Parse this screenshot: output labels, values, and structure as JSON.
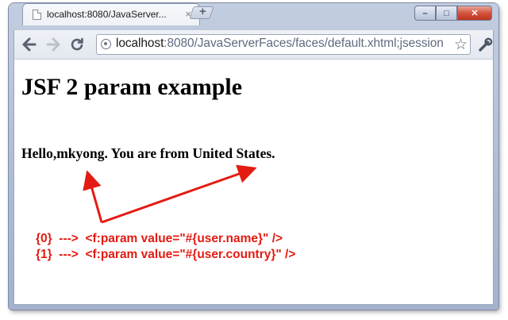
{
  "browser": {
    "tab_title": "localhost:8080/JavaServer...",
    "tab_close": "×",
    "window_controls": {
      "minimize": "–",
      "maximize": "□",
      "close": "✕"
    },
    "nav": {
      "back_icon": "arrow-left-icon",
      "forward_icon": "arrow-right-icon",
      "reload_icon": "reload-icon"
    },
    "address_bar": {
      "host": "localhost",
      "rest": ":8080/JavaServerFaces/faces/default.xhtml;jsession"
    }
  },
  "page": {
    "heading": "JSF 2 param example",
    "greeting": "Hello,mkyong. You are from United States.",
    "annotations": [
      "{0}  --->  <f:param value=\"#{user.name}\" />",
      "{1}  --->  <f:param value=\"#{user.country}\" />"
    ],
    "annotation_color": "#e31b12"
  }
}
